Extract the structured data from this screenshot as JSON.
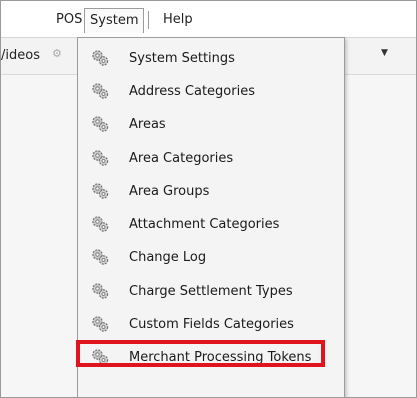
{
  "menubar": {
    "items": [
      {
        "label": "POS"
      },
      {
        "label": "System"
      },
      {
        "label": "Help"
      }
    ]
  },
  "toolbar": {
    "videos_label": "/ideos"
  },
  "system_menu": {
    "items": [
      {
        "label": "System Settings"
      },
      {
        "label": "Address Categories"
      },
      {
        "label": "Areas"
      },
      {
        "label": "Area Categories"
      },
      {
        "label": "Area Groups"
      },
      {
        "label": "Attachment Categories"
      },
      {
        "label": "Change Log"
      },
      {
        "label": "Charge Settlement Types"
      },
      {
        "label": "Custom Fields Categories"
      },
      {
        "label": "Merchant Processing Tokens"
      }
    ],
    "highlighted_index": 8,
    "highlight_color": "#e0141d",
    "item_icon": "gears-icon"
  }
}
